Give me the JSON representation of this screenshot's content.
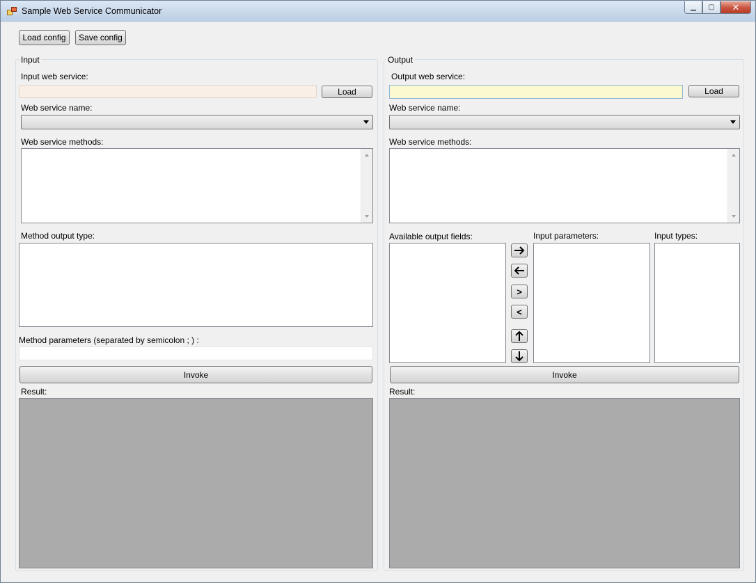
{
  "window": {
    "title": "Sample Web Service Communicator",
    "controls": {
      "minimize": "▁",
      "maximize": "▢",
      "close": "✕"
    }
  },
  "toolbar": {
    "load_config": "Load config",
    "save_config": "Save config"
  },
  "input": {
    "group_label": "Input",
    "web_service_label": "Input web service:",
    "web_service_value": "",
    "load_button": "Load",
    "service_name_label": "Web service name:",
    "service_name_value": "",
    "methods_label": "Web service methods:",
    "output_type_label": "Method output type:",
    "params_label": "Method parameters (separated by semicolon ; ) :",
    "params_value": "",
    "invoke_button": "Invoke",
    "result_label": "Result:"
  },
  "output": {
    "group_label": "Output",
    "web_service_label": "Output web service:",
    "web_service_value": "",
    "load_button": "Load",
    "service_name_label": "Web service name:",
    "service_name_value": "",
    "methods_label": "Web service methods:",
    "available_fields_label": "Available output fields:",
    "input_params_label": "Input parameters:",
    "input_types_label": "Input types:",
    "move_buttons": {
      "right_arrow": "→",
      "left_arrow": "←",
      "gt": ">",
      "lt": "<",
      "up_arrow": "↑",
      "down_arrow": "↓"
    },
    "invoke_button": "Invoke",
    "result_label": "Result:"
  },
  "colors": {
    "input_textbox_bg": "#faefe6",
    "output_textbox_bg": "#fcf8cf",
    "result_bg": "#ababab",
    "window_bg": "#f0f0f0"
  }
}
